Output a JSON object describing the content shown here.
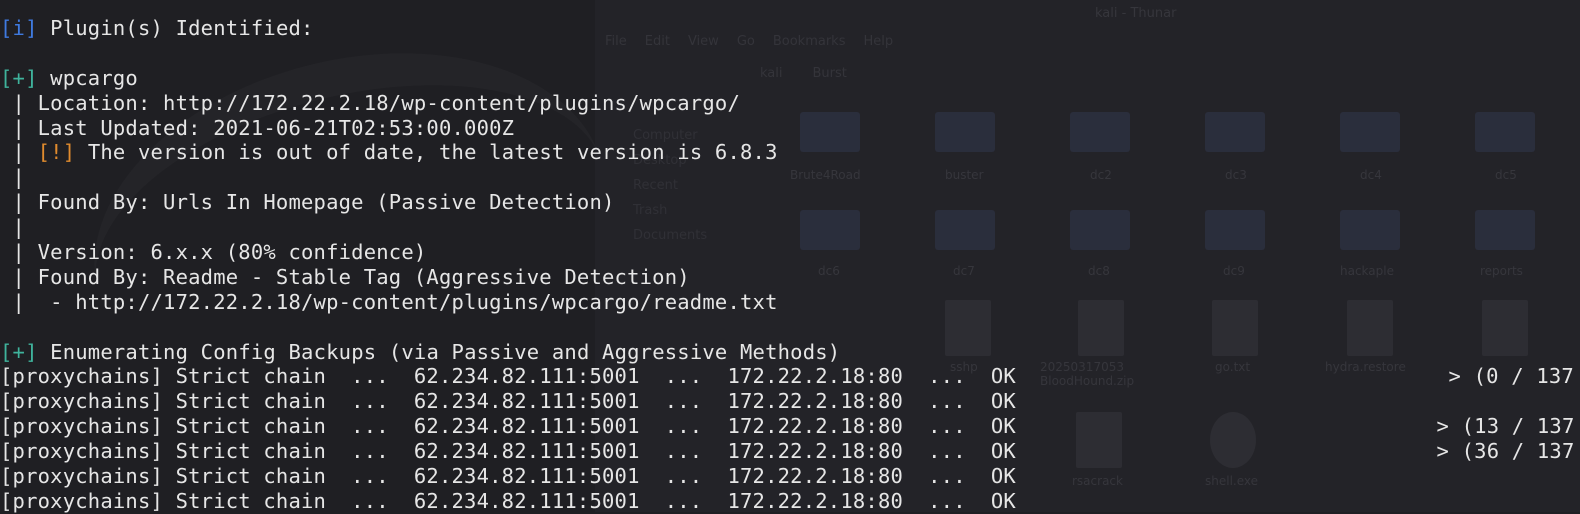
{
  "terminal": {
    "plugins_header": {
      "tag": "[i]",
      "text": " Plugin(s) Identified:"
    },
    "plugin_name": {
      "tag": "[+]",
      "text": " wpcargo"
    },
    "location": " | Location: http://172.22.2.18/wp-content/plugins/wpcargo/",
    "last_updated": " | Last Updated: 2021-06-21T02:53:00.000Z",
    "outdated": {
      "prefix": " | ",
      "tag": "[!]",
      "text": " The version is out of date, the latest version is 6.8.3"
    },
    "pipe1": " |",
    "found_by_1": " | Found By: Urls In Homepage (Passive Detection)",
    "pipe2": " |",
    "version": " | Version: 6.x.x (80% confidence)",
    "found_by_2": " | Found By: Readme - Stable Tag (Aggressive Detection)",
    "readme_url": " |  - http://172.22.2.18/wp-content/plugins/wpcargo/readme.txt",
    "config_backups": {
      "tag": "[+]",
      "text": " Enumerating Config Backups (via Passive and Aggressive Methods)"
    },
    "proxy_lines": [
      {
        "text": "[proxychains] Strict chain  ...  62.234.82.111:5001  ...  172.22.2.18:80  ...  OK",
        "progress": " > (0 / 137"
      },
      {
        "text": "[proxychains] Strict chain  ...  62.234.82.111:5001  ...  172.22.2.18:80  ...  OK",
        "progress": ""
      },
      {
        "text": "[proxychains] Strict chain  ...  62.234.82.111:5001  ...  172.22.2.18:80  ...  OK",
        "progress": " > (13 / 137"
      },
      {
        "text": "[proxychains] Strict chain  ...  62.234.82.111:5001  ...  172.22.2.18:80  ...  OK",
        "progress": " > (36 / 137"
      },
      {
        "text": "[proxychains] Strict chain  ...  62.234.82.111:5001  ...  172.22.2.18:80  ...  OK",
        "progress": ""
      },
      {
        "text": "[proxychains] Strict chain  ...  62.234.82.111:5001  ...  172.22.2.18:80  ...  OK",
        "progress": ""
      }
    ]
  },
  "background": {
    "window_title": "kali - Thunar",
    "menu": [
      "File",
      "Edit",
      "View",
      "Go",
      "Bookmarks",
      "Help"
    ],
    "path": [
      "kali",
      "Burst"
    ],
    "sidebar": [
      "Computer",
      "Desktop",
      "Recent",
      "Trash",
      "Documents"
    ],
    "folders": [
      "Brute4Road",
      "buster",
      "dc2",
      "dc3",
      "dc4",
      "dc5",
      "dc6",
      "dc7",
      "dc8",
      "dc9",
      "hackaple",
      "reports"
    ],
    "files": [
      "sshp",
      "20250317053 BloodHound.zip",
      "go.txt",
      "hydra.restore",
      "rsacrack",
      "shell.exe"
    ]
  }
}
